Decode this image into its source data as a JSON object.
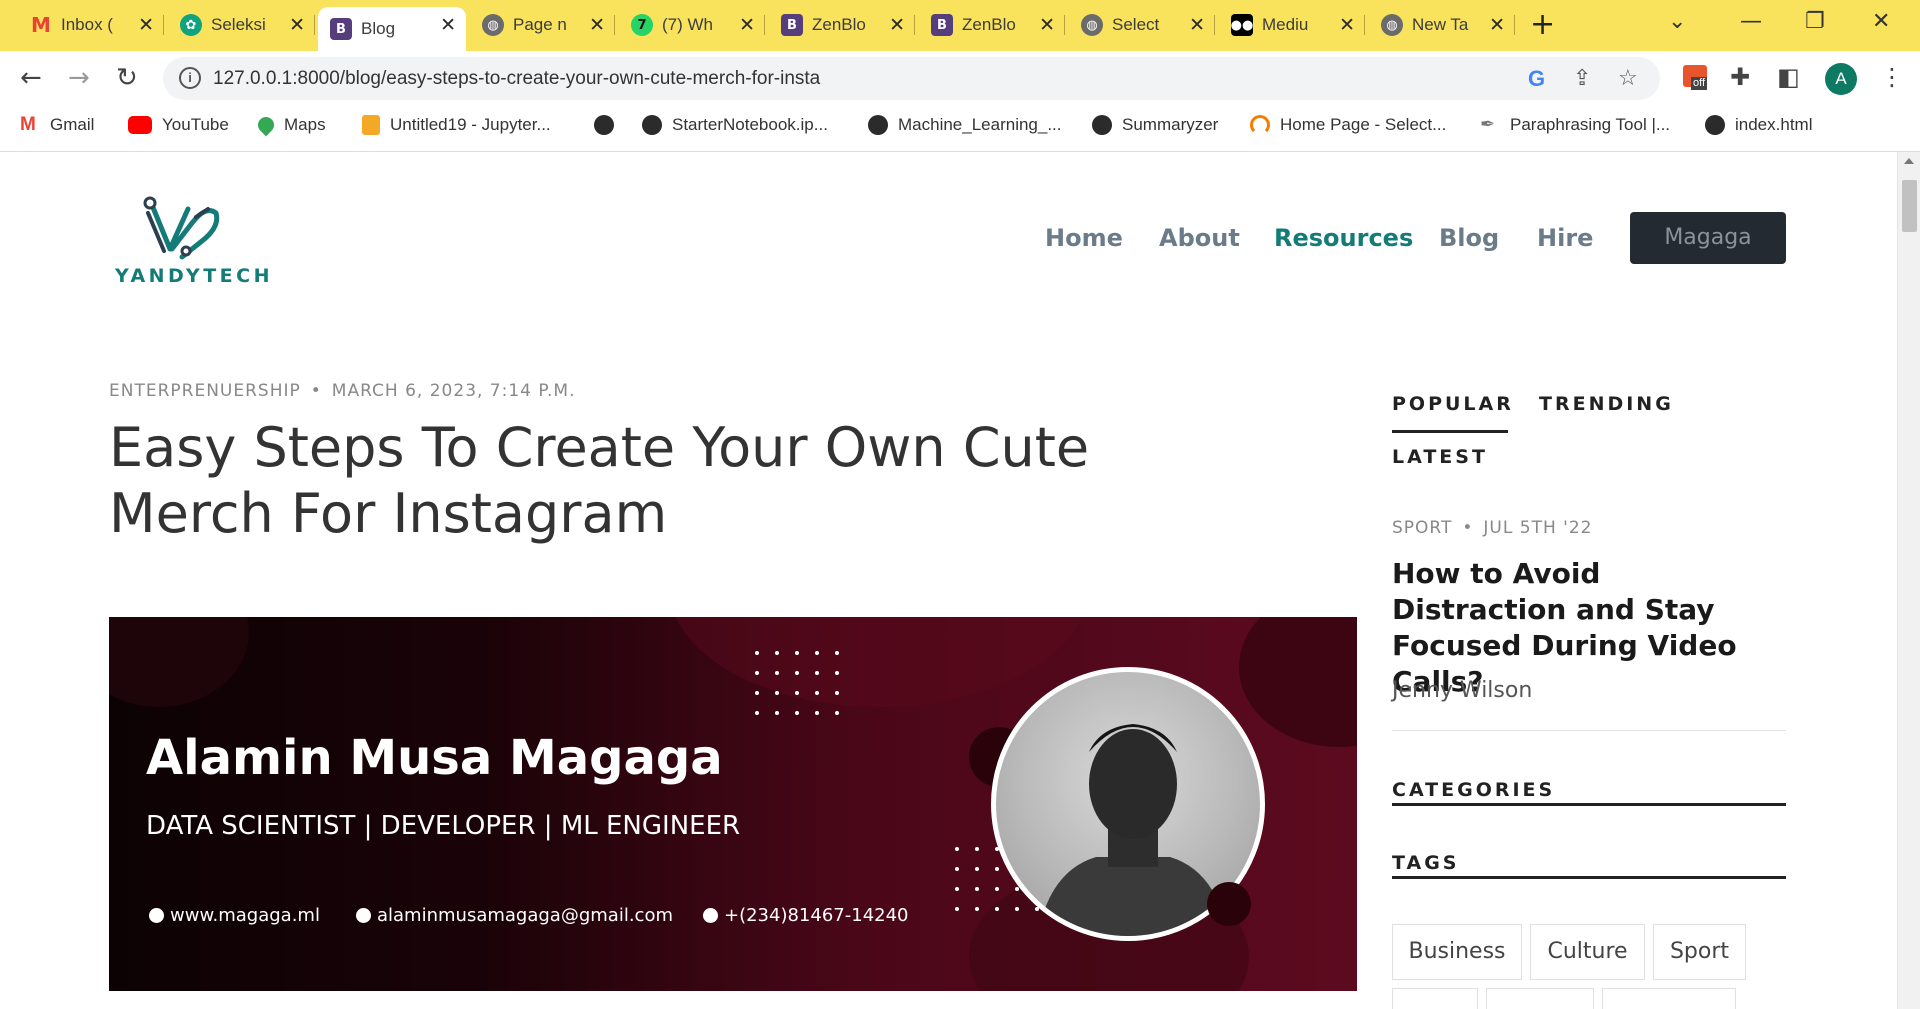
{
  "tabs": [
    {
      "title": "Inbox (",
      "icon": "gmail-icon",
      "color": "#ea4335",
      "glyph": "M"
    },
    {
      "title": "Seleksi",
      "icon": "chatgpt-icon",
      "color": "#10a37f",
      "glyph": "✿"
    },
    {
      "title": "Blog",
      "icon": "bootstrap-icon",
      "color": "#563d7c",
      "glyph": "B"
    },
    {
      "title": "Page n",
      "icon": "globe-icon",
      "color": "#5f6368",
      "glyph": "◍"
    },
    {
      "title": "(7) Wh",
      "icon": "whatsapp-icon",
      "color": "#25d366",
      "glyph": "7"
    },
    {
      "title": "ZenBlo",
      "icon": "bootstrap-icon",
      "color": "#563d7c",
      "glyph": "B"
    },
    {
      "title": "ZenBlo",
      "icon": "bootstrap-icon",
      "color": "#563d7c",
      "glyph": "B"
    },
    {
      "title": "Select",
      "icon": "globe-icon",
      "color": "#5f6368",
      "glyph": "◍"
    },
    {
      "title": "Mediu",
      "icon": "medium-icon",
      "color": "#000000",
      "glyph": "●"
    },
    {
      "title": "New Ta",
      "icon": "chrome-icon",
      "color": "#5f6368",
      "glyph": "◍"
    }
  ],
  "toolbar": {
    "url": "127.0.0.1:8000/blog/easy-steps-to-create-your-own-cute-merch-for-insta",
    "avatar_letter": "A",
    "extension_badge": "off"
  },
  "bookmarks": [
    {
      "label": "Gmail",
      "icon": "gmail-icon",
      "color": "#ea4335"
    },
    {
      "label": "YouTube",
      "icon": "youtube-icon",
      "color": "#ff0000"
    },
    {
      "label": "Maps",
      "icon": "maps-icon",
      "color": "#34a853"
    },
    {
      "label": "Untitled19 - Jupyter...",
      "icon": "jupyter-icon",
      "color": "#f37626"
    },
    {
      "label": "",
      "icon": "globe-icon",
      "color": "#333333"
    },
    {
      "label": "StarterNotebook.ip...",
      "icon": "globe-icon",
      "color": "#333333"
    },
    {
      "label": "Machine_Learning_...",
      "icon": "globe-icon",
      "color": "#333333"
    },
    {
      "label": "Summaryzer",
      "icon": "globe-icon",
      "color": "#333333"
    },
    {
      "label": "Home Page - Select...",
      "icon": "select-icon",
      "color": "#f57c00"
    },
    {
      "label": "Paraphrasing Tool |...",
      "icon": "quill-icon",
      "color": "#888888"
    },
    {
      "label": "index.html",
      "icon": "globe-icon",
      "color": "#333333"
    }
  ],
  "site": {
    "logo_text": "YANDYTECH",
    "nav": [
      {
        "label": "Home",
        "active": false
      },
      {
        "label": "About",
        "active": false
      },
      {
        "label": "Resources",
        "active": true
      },
      {
        "label": "Blog",
        "active": false
      },
      {
        "label": "Hire",
        "active": false
      }
    ],
    "cta": "Magaga",
    "accent": "#137b78"
  },
  "post": {
    "category": "ENTERPRENUERSHIP",
    "date": "MARCH 6, 2023, 7:14 P.M.",
    "title": "Easy Steps To Create Your Own Cute Merch For Instagram"
  },
  "banner": {
    "name": "Alamin Musa Magaga",
    "role": "DATA SCIENTIST | DEVELOPER | ML ENGINEER",
    "website": "www.magaga.ml",
    "email": "alaminmusamagaga@gmail.com",
    "phone": "+(234)81467-14240"
  },
  "sidebar": {
    "tabs": [
      "POPULAR",
      "TRENDING",
      "LATEST"
    ],
    "post": {
      "category": "SPORT",
      "date": "JUL 5TH '22",
      "title": "How to Avoid Distraction and Stay Focused During Video Calls?",
      "author": "Jenny Wilson"
    },
    "categories_heading": "CATEGORIES",
    "tags_heading": "TAGS",
    "tags": [
      "Business",
      "Culture",
      "Sport"
    ]
  }
}
